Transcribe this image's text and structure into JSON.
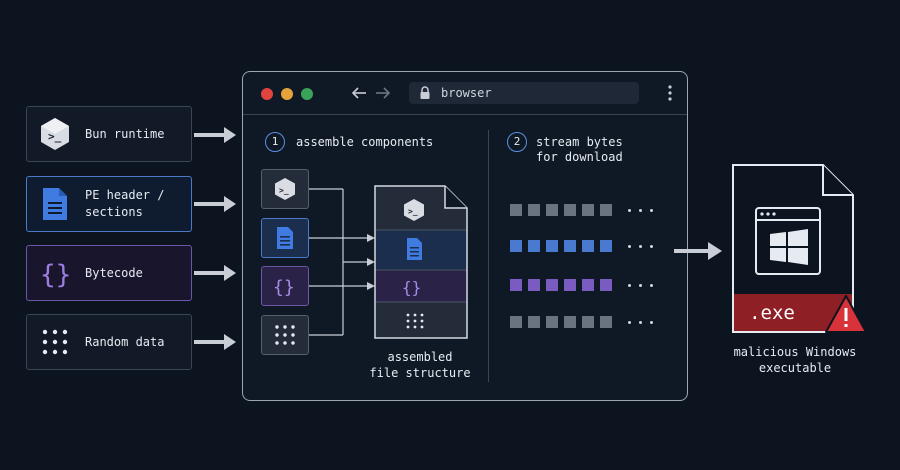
{
  "sources": [
    {
      "label": "Bun runtime",
      "icon": "terminal-hex-icon",
      "style": "gray"
    },
    {
      "label": "PE header /\nsections",
      "icon": "document-icon",
      "style": "blue"
    },
    {
      "label": "Bytecode",
      "icon": "braces-icon",
      "style": "purple"
    },
    {
      "label": "Random data",
      "icon": "dot-grid-icon",
      "style": "gray"
    }
  ],
  "browser": {
    "url": "browser",
    "step1": {
      "number": "1",
      "label": "assemble components"
    },
    "step2": {
      "number": "2",
      "label": "stream bytes\nfor download"
    },
    "assembled_caption": "assembled\nfile structure",
    "byte_rows": [
      {
        "color": "#6b7380",
        "squares": 6
      },
      {
        "color": "#4a7ad0",
        "squares": 6
      },
      {
        "color": "#7a5cc0",
        "squares": 6
      },
      {
        "color": "#6b7380",
        "squares": 6
      }
    ]
  },
  "output": {
    "extension": ".exe",
    "caption": "malicious Windows\nexecutable"
  },
  "colors": {
    "background": "#0c1420",
    "blue_accent": "#4a7ad0",
    "purple_accent": "#7a5cc0",
    "danger_red": "#8e1f24",
    "traffic_red": "#e0443e",
    "traffic_yellow": "#e6a33a",
    "traffic_green": "#3aa35a"
  }
}
